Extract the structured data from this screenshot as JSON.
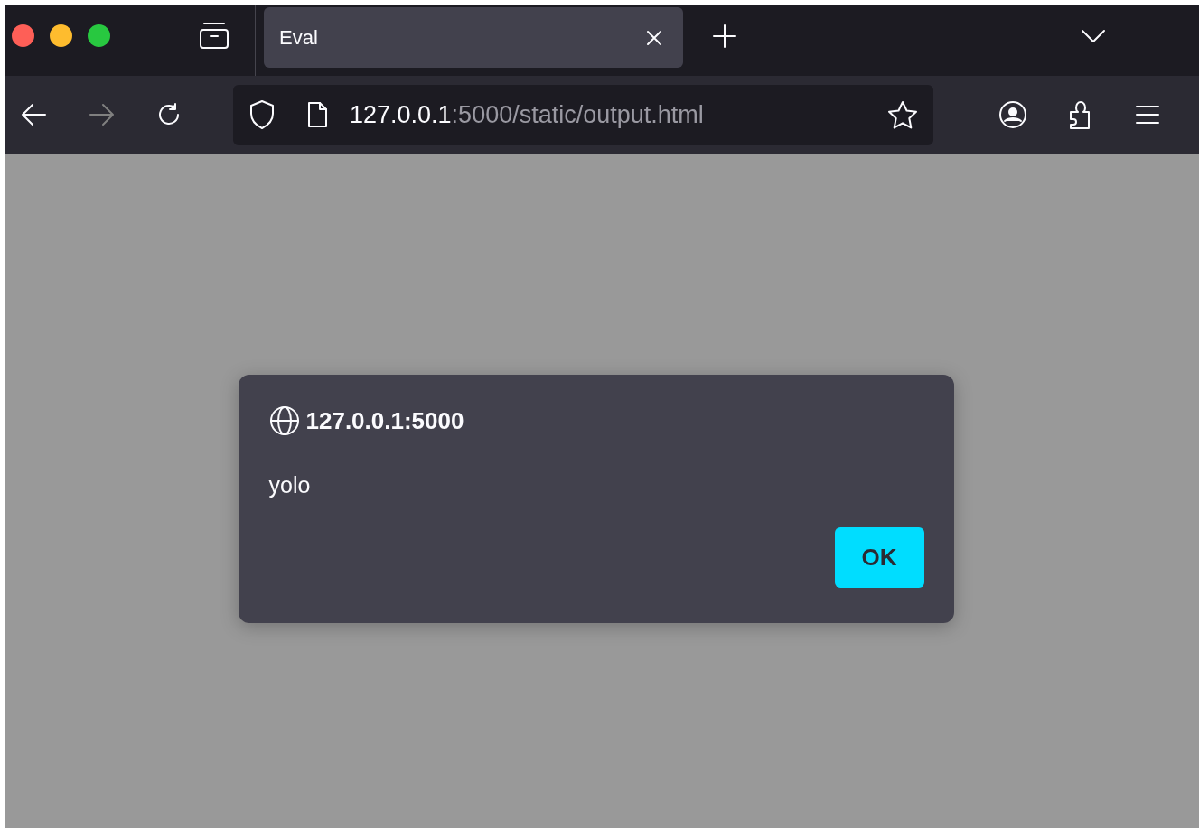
{
  "tabs": [
    {
      "title": "Eval",
      "selected": true
    }
  ],
  "toolbar": {
    "back_disabled": false,
    "forward_disabled": true
  },
  "address_bar": {
    "host": "127.0.0.1",
    "rest": ":5000/static/output.html"
  },
  "dialog": {
    "origin": "127.0.0.1:5000",
    "message": "yolo",
    "buttons": [
      "OK"
    ]
  }
}
